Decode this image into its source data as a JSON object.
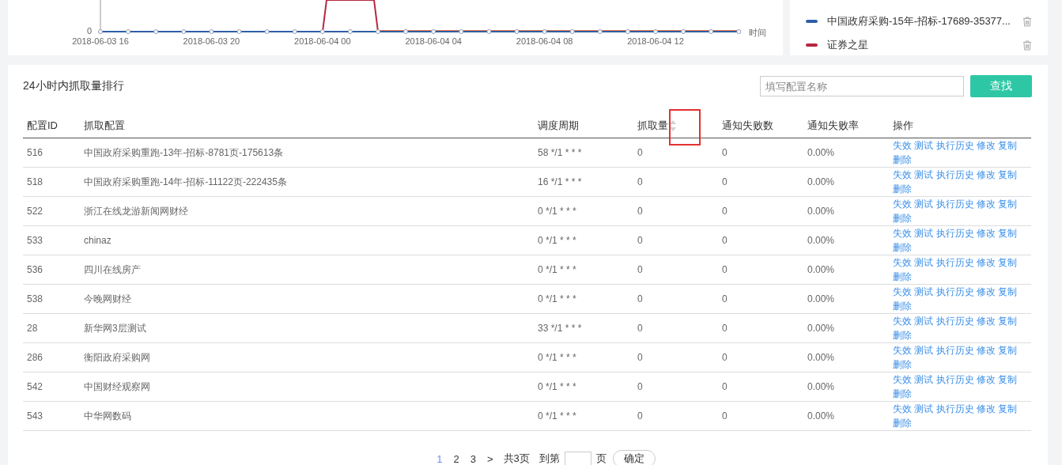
{
  "chart": {
    "y_tick": "0",
    "x_labels": [
      "2018-06-03 16",
      "2018-06-03 20",
      "2018-06-04 00",
      "2018-06-04 04",
      "2018-06-04 08",
      "2018-06-04 12"
    ],
    "x_axis_label": "时间"
  },
  "legend": [
    {
      "name": "中国政府采购-15年-招标-17689-35377...",
      "color": "#2f5ea8"
    },
    {
      "name": "证券之星",
      "color": "#b8263f"
    }
  ],
  "ranking": {
    "title": "24小时内抓取量排行",
    "search": {
      "placeholder": "填写配置名称"
    },
    "search_button": "查找",
    "columns": [
      {
        "label": "配置ID",
        "sortable": false,
        "highlighted": false
      },
      {
        "label": "抓取配置",
        "sortable": false,
        "highlighted": false
      },
      {
        "label": "调度周期",
        "sortable": false,
        "highlighted": false
      },
      {
        "label": "抓取量",
        "sortable": true,
        "highlighted": true
      },
      {
        "label": "通知失败数",
        "sortable": false,
        "highlighted": false
      },
      {
        "label": "通知失败率",
        "sortable": false,
        "highlighted": false
      },
      {
        "label": "操作",
        "sortable": false,
        "highlighted": false
      }
    ],
    "rows": [
      {
        "id": "516",
        "name": "中国政府采购重跑-13年-招标-8781页-175613条",
        "period": "58 */1 * * *",
        "count": "0",
        "fail_count": "0",
        "fail_rate": "0.00%",
        "actions": [
          "失效",
          "测试",
          "执行历史",
          "修改",
          "复制",
          "删除"
        ]
      },
      {
        "id": "518",
        "name": "中国政府采购重跑-14年-招标-11122页-222435条",
        "period": "16 */1 * * *",
        "count": "0",
        "fail_count": "0",
        "fail_rate": "0.00%",
        "actions": [
          "失效",
          "测试",
          "执行历史",
          "修改",
          "复制",
          "删除"
        ]
      },
      {
        "id": "522",
        "name": "浙江在线龙游新闻网财经",
        "period": "0 */1 * * *",
        "count": "0",
        "fail_count": "0",
        "fail_rate": "0.00%",
        "actions": [
          "失效",
          "测试",
          "执行历史",
          "修改",
          "复制",
          "删除"
        ]
      },
      {
        "id": "533",
        "name": "chinaz",
        "period": "0 */1 * * *",
        "count": "0",
        "fail_count": "0",
        "fail_rate": "0.00%",
        "actions": [
          "失效",
          "测试",
          "执行历史",
          "修改",
          "复制",
          "删除"
        ]
      },
      {
        "id": "536",
        "name": "四川在线房产",
        "period": "0 */1 * * *",
        "count": "0",
        "fail_count": "0",
        "fail_rate": "0.00%",
        "actions": [
          "失效",
          "测试",
          "执行历史",
          "修改",
          "复制",
          "删除"
        ]
      },
      {
        "id": "538",
        "name": "今晚网财经",
        "period": "0 */1 * * *",
        "count": "0",
        "fail_count": "0",
        "fail_rate": "0.00%",
        "actions": [
          "失效",
          "测试",
          "执行历史",
          "修改",
          "复制",
          "删除"
        ]
      },
      {
        "id": "28",
        "name": "新华网3层测试",
        "period": "33 */1 * * *",
        "count": "0",
        "fail_count": "0",
        "fail_rate": "0.00%",
        "actions": [
          "失效",
          "测试",
          "执行历史",
          "修改",
          "复制",
          "删除"
        ]
      },
      {
        "id": "286",
        "name": "衡阳政府采购网",
        "period": "0 */1 * * *",
        "count": "0",
        "fail_count": "0",
        "fail_rate": "0.00%",
        "actions": [
          "失效",
          "测试",
          "执行历史",
          "修改",
          "复制",
          "删除"
        ]
      },
      {
        "id": "542",
        "name": "中国财经观察网",
        "period": "0 */1 * * *",
        "count": "0",
        "fail_count": "0",
        "fail_rate": "0.00%",
        "actions": [
          "失效",
          "测试",
          "执行历史",
          "修改",
          "复制",
          "删除"
        ]
      },
      {
        "id": "543",
        "name": "中华网数码",
        "period": "0 */1 * * *",
        "count": "0",
        "fail_count": "0",
        "fail_rate": "0.00%",
        "actions": [
          "失效",
          "测试",
          "执行历史",
          "修改",
          "复制",
          "删除"
        ]
      }
    ]
  },
  "pagination": {
    "pages": [
      {
        "label": "1",
        "selected": true
      },
      {
        "label": "2",
        "selected": false
      },
      {
        "label": "3",
        "selected": false
      }
    ],
    "next": ">",
    "total": "共3页",
    "goto_label": "到第",
    "goto_suffix": "页",
    "confirm": "确定"
  }
}
